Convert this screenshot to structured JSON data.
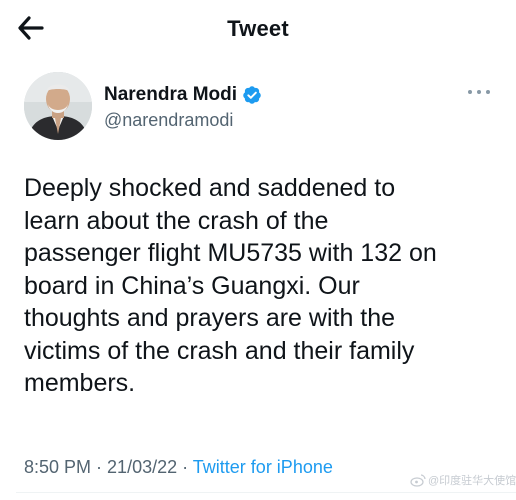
{
  "header": {
    "title": "Tweet",
    "back_icon": "arrow-left-icon"
  },
  "author": {
    "display_name": "Narendra Modi",
    "handle": "@narendramodi",
    "verified_icon": "verified-badge-icon",
    "more_icon": "more-horizontal-icon"
  },
  "tweet": {
    "text": "Deeply shocked and saddened to\nlearn about the crash of the\npassenger flight MU5735 with 132 on\nboard in China’s Guangxi. Our\nthoughts and prayers are with the\nvictims of the crash and their family\nmembers."
  },
  "meta": {
    "time": "8:50 PM",
    "separator": " · ",
    "date": "21/03/22",
    "source": "Twitter for iPhone"
  },
  "watermark": {
    "text": "@印度驻华大使馆"
  },
  "colors": {
    "link": "#1d9bf0",
    "secondary_text": "#536471",
    "verified": "#1d9bf0"
  }
}
